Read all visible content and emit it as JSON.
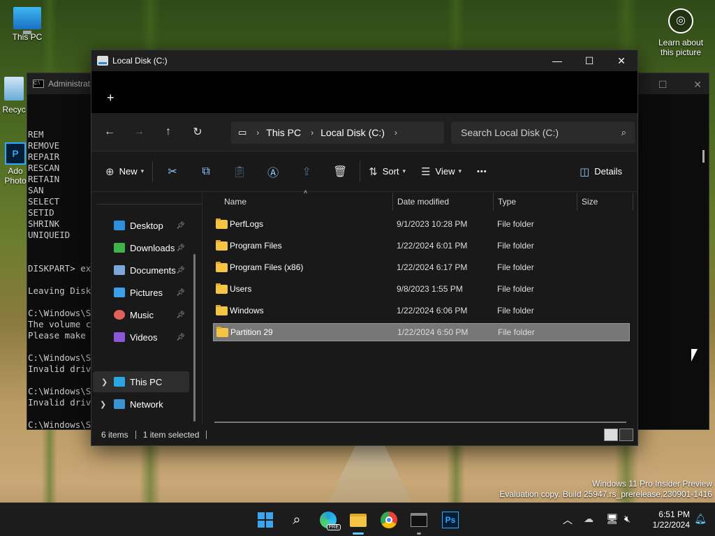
{
  "desktop": {
    "icons": [
      {
        "label": "This PC"
      },
      {
        "label": "Recyc"
      },
      {
        "label": "Ado"
      },
      {
        "label": "Photo"
      }
    ],
    "learn_line1": "Learn about",
    "learn_line2": "this picture",
    "watermark_line1": "Windows 11 Pro Insider Preview",
    "watermark_line2": "Evaluation copy. Build 25947.rs_prerelease.230901-1416"
  },
  "cmd": {
    "title": "Administrat",
    "lines": [
      "REM",
      "REMOVE",
      "REPAIR",
      "RESCAN",
      "RETAIN",
      "SAN",
      "SELECT",
      "SETID",
      "SHRINK",
      "UNIQUEID",
      "",
      "",
      "DISKPART> ex",
      "",
      "Leaving Disk",
      "",
      "C:\\Windows\\S",
      "The volume c",
      "Please make",
      "",
      "C:\\Windows\\S",
      "Invalid driv",
      "",
      "C:\\Windows\\S",
      "Invalid driv",
      "",
      "C:\\Windows\\S"
    ]
  },
  "explorer": {
    "title": "Local Disk (C:)",
    "new_tab": "+",
    "breadcrumb": [
      "This PC",
      "Local Disk (C:)"
    ],
    "search_placeholder": "Search Local Disk (C:)",
    "toolbar": {
      "new": "New",
      "sort": "Sort",
      "view": "View",
      "more": "•••",
      "details": "Details"
    },
    "nav": {
      "quick": [
        {
          "label": "Desktop",
          "color": "#2f8fdc"
        },
        {
          "label": "Downloads",
          "color": "#3fb24c"
        },
        {
          "label": "Documents",
          "color": "#7aa7d8"
        },
        {
          "label": "Pictures",
          "color": "#3aa0e8"
        },
        {
          "label": "Music",
          "color": "#e0605a"
        },
        {
          "label": "Videos",
          "color": "#8a58d6"
        }
      ],
      "this_pc": "This PC",
      "network": "Network"
    },
    "columns": {
      "name": "Name",
      "date": "Date modified",
      "type": "Type",
      "size": "Size"
    },
    "rows": [
      {
        "name": "PerfLogs",
        "date": "9/1/2023 10:28 PM",
        "type": "File folder"
      },
      {
        "name": "Program Files",
        "date": "1/22/2024 6:01 PM",
        "type": "File folder"
      },
      {
        "name": "Program Files (x86)",
        "date": "1/22/2024 6:17 PM",
        "type": "File folder"
      },
      {
        "name": "Users",
        "date": "9/8/2023 1:55 PM",
        "type": "File folder"
      },
      {
        "name": "Windows",
        "date": "1/22/2024 6:06 PM",
        "type": "File folder"
      },
      {
        "name": "Partition 29",
        "date": "1/22/2024 6:50 PM",
        "type": "File folder"
      }
    ],
    "status": {
      "count": "6 items",
      "selected": "1 item selected"
    }
  },
  "taskbar": {
    "time": "6:51 PM",
    "date": "1/22/2024",
    "edge_badge": "PRE",
    "ps_label": "Ps"
  }
}
